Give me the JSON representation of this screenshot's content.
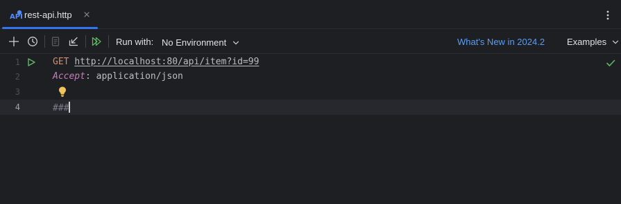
{
  "tab": {
    "title": "rest-api.http",
    "icon": "api-file-icon"
  },
  "toolbar": {
    "run_with_label": "Run with:",
    "environment": "No Environment",
    "whats_new": "What's New in 2024.2",
    "examples": "Examples"
  },
  "editor": {
    "lines": [
      {
        "number": "1",
        "method": "GET",
        "url": "http://localhost:80/api/item?id=99"
      },
      {
        "number": "2",
        "header_name": "Accept",
        "colon": ":",
        "header_value": " application/json"
      },
      {
        "number": "3"
      },
      {
        "number": "4",
        "text": "###"
      }
    ],
    "current_line": "4"
  },
  "colors": {
    "accent": "#3574f0",
    "link": "#589df6",
    "run_green": "#5fb865",
    "method": "#cf8e6d",
    "header": "#c77dbb"
  }
}
